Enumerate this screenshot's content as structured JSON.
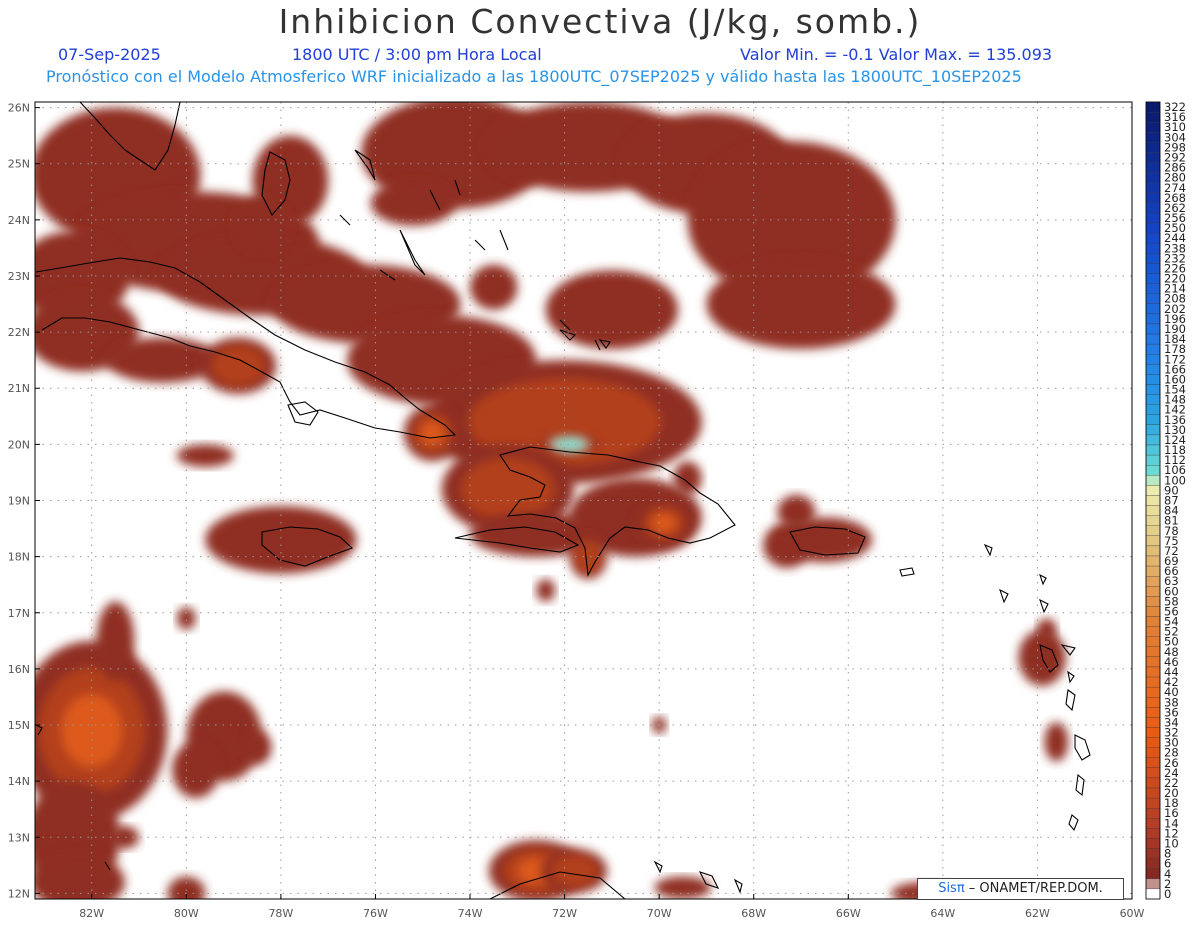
{
  "header": {
    "title": "Inhibicion Convectiva (J/kg, somb.)",
    "date": "07-Sep-2025",
    "time": "1800 UTC / 3:00 pm Hora Local",
    "range": "Valor Min. = -0.1  Valor Max. = 135.093",
    "model": "Pronóstico con el Modelo Atmosferico WRF inicializado a las 1800UTC_07SEP2025 y válido hasta las  1800UTC_10SEP2025"
  },
  "axes": {
    "lat_labels": [
      "26N",
      "25N",
      "24N",
      "23N",
      "22N",
      "21N",
      "20N",
      "19N",
      "18N",
      "17N",
      "16N",
      "15N",
      "14N",
      "13N",
      "12N"
    ],
    "lat_values": [
      26,
      25,
      24,
      23,
      22,
      21,
      20,
      19,
      18,
      17,
      16,
      15,
      14,
      13,
      12
    ],
    "lon_labels": [
      "82W",
      "80W",
      "78W",
      "76W",
      "74W",
      "72W",
      "70W",
      "68W",
      "66W",
      "64W",
      "62W",
      "60W"
    ],
    "lon_values": [
      -82,
      -80,
      -78,
      -76,
      -74,
      -72,
      -70,
      -68,
      -66,
      -64,
      -62,
      -60
    ],
    "lon_range": [
      -83.2,
      -60
    ],
    "lat_range": [
      11.9,
      26.1
    ],
    "grid": true
  },
  "colorbar": {
    "labels": [
      "322",
      "316",
      "310",
      "304",
      "298",
      "292",
      "286",
      "280",
      "274",
      "268",
      "262",
      "256",
      "250",
      "244",
      "238",
      "232",
      "226",
      "220",
      "214",
      "208",
      "202",
      "196",
      "190",
      "184",
      "178",
      "172",
      "166",
      "160",
      "154",
      "148",
      "142",
      "136",
      "130",
      "124",
      "118",
      "112",
      "106",
      "100",
      "90",
      "87",
      "84",
      "81",
      "78",
      "75",
      "72",
      "69",
      "66",
      "63",
      "60",
      "58",
      "56",
      "54",
      "52",
      "50",
      "48",
      "46",
      "44",
      "42",
      "40",
      "38",
      "36",
      "34",
      "32",
      "30",
      "28",
      "26",
      "24",
      "22",
      "20",
      "18",
      "16",
      "14",
      "12",
      "10",
      "8",
      "6",
      "4",
      "2",
      "0"
    ]
  },
  "regions": [
    {
      "lon": -81.5,
      "lat": 24.8,
      "rx": 1.8,
      "ry": 1.2,
      "intensity": 0.2
    },
    {
      "lon": -79.8,
      "lat": 23.6,
      "rx": 2.6,
      "ry": 0.9,
      "intensity": 0.35
    },
    {
      "lon": -78.4,
      "lat": 23.0,
      "rx": 2.2,
      "ry": 0.7,
      "intensity": 0.3
    },
    {
      "lon": -76.2,
      "lat": 22.5,
      "rx": 2.0,
      "ry": 0.7,
      "intensity": 0.25
    },
    {
      "lon": -74.6,
      "lat": 21.5,
      "rx": 2.0,
      "ry": 0.8,
      "intensity": 0.35
    },
    {
      "lon": -82.4,
      "lat": 23.0,
      "rx": 1.2,
      "ry": 0.8,
      "intensity": 0.2
    },
    {
      "lon": -82.2,
      "lat": 22.0,
      "rx": 1.2,
      "ry": 0.7,
      "intensity": 0.2
    },
    {
      "lon": -80.5,
      "lat": 21.5,
      "rx": 1.2,
      "ry": 0.4,
      "intensity": 0.15
    },
    {
      "lon": -78.9,
      "lat": 21.4,
      "rx": 0.8,
      "ry": 0.5,
      "intensity": 0.4
    },
    {
      "lon": -77.8,
      "lat": 24.7,
      "rx": 0.8,
      "ry": 0.8,
      "intensity": 0.35
    },
    {
      "lon": -78.4,
      "lat": 23.9,
      "rx": 0.6,
      "ry": 0.5,
      "intensity": 0.3
    },
    {
      "lon": -74.3,
      "lat": 25.2,
      "rx": 2.0,
      "ry": 1.0,
      "intensity": 0.25
    },
    {
      "lon": -75.2,
      "lat": 24.3,
      "rx": 0.9,
      "ry": 0.4,
      "intensity": 0.2
    },
    {
      "lon": -71.5,
      "lat": 25.3,
      "rx": 2.2,
      "ry": 0.8,
      "intensity": 0.2
    },
    {
      "lon": -69.0,
      "lat": 25.0,
      "rx": 1.8,
      "ry": 0.9,
      "intensity": 0.15
    },
    {
      "lon": -67.2,
      "lat": 24.0,
      "rx": 2.2,
      "ry": 1.4,
      "intensity": 0.15
    },
    {
      "lon": -67.0,
      "lat": 22.5,
      "rx": 2.0,
      "ry": 0.8,
      "intensity": 0.15
    },
    {
      "lon": -71.0,
      "lat": 22.4,
      "rx": 1.4,
      "ry": 0.7,
      "intensity": 0.2
    },
    {
      "lon": -73.5,
      "lat": 22.8,
      "rx": 0.5,
      "ry": 0.4,
      "intensity": 0.2
    },
    {
      "lon": -72.0,
      "lat": 20.4,
      "rx": 2.9,
      "ry": 1.1,
      "intensity": 0.45
    },
    {
      "lon": -71.9,
      "lat": 20.0,
      "rx": 0.6,
      "ry": 0.2,
      "intensity": 1.0
    },
    {
      "lon": -74.8,
      "lat": 20.2,
      "rx": 0.6,
      "ry": 0.5,
      "intensity": 0.55
    },
    {
      "lon": -73.2,
      "lat": 19.2,
      "rx": 1.4,
      "ry": 0.8,
      "intensity": 0.45
    },
    {
      "lon": -72.6,
      "lat": 18.4,
      "rx": 1.4,
      "ry": 0.4,
      "intensity": 0.35
    },
    {
      "lon": -70.5,
      "lat": 18.7,
      "rx": 1.4,
      "ry": 0.7,
      "intensity": 0.35
    },
    {
      "lon": -69.9,
      "lat": 18.6,
      "rx": 0.6,
      "ry": 0.4,
      "intensity": 0.5
    },
    {
      "lon": -71.5,
      "lat": 18.0,
      "rx": 0.4,
      "ry": 0.4,
      "intensity": 0.45
    },
    {
      "lon": -69.4,
      "lat": 19.4,
      "rx": 0.3,
      "ry": 0.3,
      "intensity": 0.25
    },
    {
      "lon": -78.0,
      "lat": 18.3,
      "rx": 1.6,
      "ry": 0.6,
      "intensity": 0.3
    },
    {
      "lon": -67.3,
      "lat": 18.2,
      "rx": 0.5,
      "ry": 0.4,
      "intensity": 0.15
    },
    {
      "lon": -66.5,
      "lat": 18.3,
      "rx": 1.0,
      "ry": 0.4,
      "intensity": 0.15
    },
    {
      "lon": -67.1,
      "lat": 18.8,
      "rx": 0.4,
      "ry": 0.3,
      "intensity": 0.15
    },
    {
      "lon": -79.6,
      "lat": 19.8,
      "rx": 0.6,
      "ry": 0.2,
      "intensity": 0.15
    },
    {
      "lon": -82.0,
      "lat": 14.9,
      "rx": 1.6,
      "ry": 1.6,
      "intensity": 0.5
    },
    {
      "lon": -82.4,
      "lat": 13.0,
      "rx": 1.0,
      "ry": 1.0,
      "intensity": 0.35
    },
    {
      "lon": -82.3,
      "lat": 12.2,
      "rx": 1.0,
      "ry": 0.5,
      "intensity": 0.3
    },
    {
      "lon": -81.5,
      "lat": 16.5,
      "rx": 0.4,
      "ry": 0.7,
      "intensity": 0.25
    },
    {
      "lon": -79.2,
      "lat": 14.8,
      "rx": 0.8,
      "ry": 0.8,
      "intensity": 0.2
    },
    {
      "lon": -79.8,
      "lat": 14.2,
      "rx": 0.5,
      "ry": 0.5,
      "intensity": 0.2
    },
    {
      "lon": -78.5,
      "lat": 14.6,
      "rx": 0.3,
      "ry": 0.3,
      "intensity": 0.2
    },
    {
      "lon": -81.3,
      "lat": 13.0,
      "rx": 0.3,
      "ry": 0.2,
      "intensity": 0.2
    },
    {
      "lon": -80.0,
      "lat": 16.9,
      "rx": 0.2,
      "ry": 0.2,
      "intensity": 0.2
    },
    {
      "lon": -72.6,
      "lat": 12.4,
      "rx": 1.0,
      "ry": 0.55,
      "intensity": 0.6
    },
    {
      "lon": -71.8,
      "lat": 12.4,
      "rx": 0.7,
      "ry": 0.4,
      "intensity": 0.4
    },
    {
      "lon": -80.0,
      "lat": 12.0,
      "rx": 0.4,
      "ry": 0.3,
      "intensity": 0.2
    },
    {
      "lon": -69.5,
      "lat": 12.1,
      "rx": 0.6,
      "ry": 0.2,
      "intensity": 0.2
    },
    {
      "lon": -72.4,
      "lat": 17.4,
      "rx": 0.2,
      "ry": 0.2,
      "intensity": 0.3
    },
    {
      "lon": -70.0,
      "lat": 15.0,
      "rx": 0.15,
      "ry": 0.15,
      "intensity": 0.2
    },
    {
      "lon": -61.9,
      "lat": 16.2,
      "rx": 0.5,
      "ry": 0.5,
      "intensity": 0.15
    },
    {
      "lon": -61.8,
      "lat": 16.7,
      "rx": 0.2,
      "ry": 0.2,
      "intensity": 0.15
    },
    {
      "lon": -61.6,
      "lat": 14.7,
      "rx": 0.25,
      "ry": 0.35,
      "intensity": 0.15
    },
    {
      "lon": -64.4,
      "lat": 12.0,
      "rx": 0.7,
      "ry": 0.2,
      "intensity": 0.2
    }
  ],
  "credit": {
    "brand": "Sisπ",
    "text": " – ONAMET/REP.DOM."
  }
}
